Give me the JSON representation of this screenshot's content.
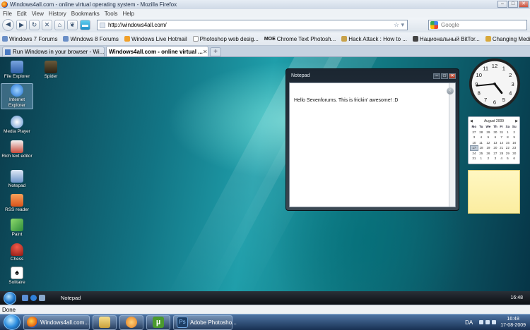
{
  "window": {
    "title": "Windows4all.com - online virtual operating system - Mozilla Firefox",
    "controls": [
      "–",
      "□",
      "✕"
    ]
  },
  "menu": [
    "File",
    "Edit",
    "View",
    "History",
    "Bookmarks",
    "Tools",
    "Help"
  ],
  "nav": {
    "url": "http://windows4all.com/",
    "search_placeholder": "Google"
  },
  "bookmarks": [
    "Windows 7 Forums",
    "Windows 8 Forums",
    "Windows Live Hotmail",
    "Photoshop web desig...",
    "Chrome Text Photosh...",
    "Hack Attack : How to ...",
    "Национальный BitTor...",
    "Changing Media Cent..."
  ],
  "bookmark_prefix_moe": "MOE",
  "tabs": [
    {
      "label": "Run Windows in your browser - Wi...",
      "active": false
    },
    {
      "label": "Windows4all.com - online virtual ...",
      "active": true
    }
  ],
  "desktop": {
    "icons": [
      {
        "label": "File Explorer",
        "color": "#4a78c4"
      },
      {
        "label": "Internet Explorer",
        "color": "#2f7fd8"
      },
      {
        "label": "Media Player",
        "color": "#3c6fb0"
      },
      {
        "label": "Rich text editor",
        "color": "#b44a3a"
      },
      {
        "label": "Notepad",
        "color": "#6b93c8"
      },
      {
        "label": "RSS reader",
        "color": "#e26b23"
      },
      {
        "label": "Paint",
        "color": "#4fae4a"
      },
      {
        "label": "Chess",
        "color": "#c8332a"
      },
      {
        "label": "Solitaire",
        "color": "#e6e6e6"
      }
    ],
    "spider_label": "Spider",
    "notepad": {
      "title": "Notepad",
      "text": "Hello Sevenforums. This is frickin' awesome! :D"
    },
    "calendar": {
      "month": "August 2009",
      "days": [
        "Mo",
        "Tu",
        "We",
        "Th",
        "Fr",
        "Sa",
        "Su"
      ],
      "weeks": [
        [
          "27",
          "28",
          "29",
          "30",
          "31",
          "1",
          "2"
        ],
        [
          "3",
          "4",
          "5",
          "6",
          "7",
          "8",
          "9"
        ],
        [
          "10",
          "11",
          "12",
          "13",
          "14",
          "15",
          "16"
        ],
        [
          "17",
          "18",
          "19",
          "20",
          "21",
          "22",
          "23"
        ],
        [
          "24",
          "25",
          "26",
          "27",
          "28",
          "29",
          "30"
        ],
        [
          "31",
          "1",
          "2",
          "3",
          "4",
          "5",
          "6"
        ]
      ],
      "today": "17"
    },
    "clock": {
      "hour": 4,
      "minute": 44
    },
    "vtaskbar": {
      "active_window": "Notepad",
      "time": "16:48"
    }
  },
  "status": {
    "text": "Done"
  },
  "taskbar": {
    "buttons": [
      {
        "label": "Windows4all.com...",
        "color": "#e26b23"
      },
      {
        "label": "",
        "color": "#d6b95a"
      },
      {
        "label": "",
        "color": "#3a7ed8"
      },
      {
        "label": "µ",
        "color": "#4a9a2e"
      },
      {
        "label": "Adobe Photosho...",
        "color": "#1e3f66"
      }
    ],
    "ps_text": "Ps",
    "lang": "DA",
    "time": "16:48",
    "date": "17-08-2009"
  }
}
